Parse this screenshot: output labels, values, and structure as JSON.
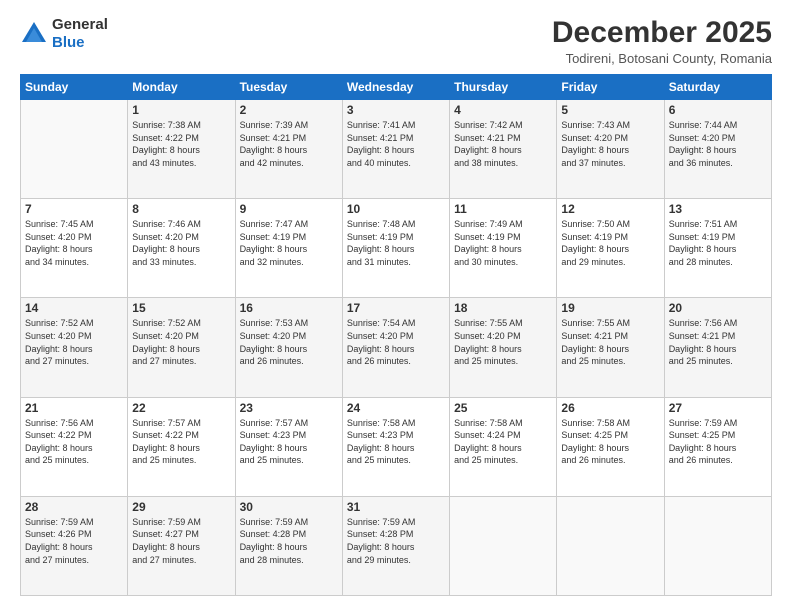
{
  "logo": {
    "general": "General",
    "blue": "Blue"
  },
  "header": {
    "month": "December 2025",
    "location": "Todireni, Botosani County, Romania"
  },
  "days_of_week": [
    "Sunday",
    "Monday",
    "Tuesday",
    "Wednesday",
    "Thursday",
    "Friday",
    "Saturday"
  ],
  "weeks": [
    [
      {
        "day": "",
        "info": ""
      },
      {
        "day": "1",
        "info": "Sunrise: 7:38 AM\nSunset: 4:22 PM\nDaylight: 8 hours\nand 43 minutes."
      },
      {
        "day": "2",
        "info": "Sunrise: 7:39 AM\nSunset: 4:21 PM\nDaylight: 8 hours\nand 42 minutes."
      },
      {
        "day": "3",
        "info": "Sunrise: 7:41 AM\nSunset: 4:21 PM\nDaylight: 8 hours\nand 40 minutes."
      },
      {
        "day": "4",
        "info": "Sunrise: 7:42 AM\nSunset: 4:21 PM\nDaylight: 8 hours\nand 38 minutes."
      },
      {
        "day": "5",
        "info": "Sunrise: 7:43 AM\nSunset: 4:20 PM\nDaylight: 8 hours\nand 37 minutes."
      },
      {
        "day": "6",
        "info": "Sunrise: 7:44 AM\nSunset: 4:20 PM\nDaylight: 8 hours\nand 36 minutes."
      }
    ],
    [
      {
        "day": "7",
        "info": "Sunrise: 7:45 AM\nSunset: 4:20 PM\nDaylight: 8 hours\nand 34 minutes."
      },
      {
        "day": "8",
        "info": "Sunrise: 7:46 AM\nSunset: 4:20 PM\nDaylight: 8 hours\nand 33 minutes."
      },
      {
        "day": "9",
        "info": "Sunrise: 7:47 AM\nSunset: 4:19 PM\nDaylight: 8 hours\nand 32 minutes."
      },
      {
        "day": "10",
        "info": "Sunrise: 7:48 AM\nSunset: 4:19 PM\nDaylight: 8 hours\nand 31 minutes."
      },
      {
        "day": "11",
        "info": "Sunrise: 7:49 AM\nSunset: 4:19 PM\nDaylight: 8 hours\nand 30 minutes."
      },
      {
        "day": "12",
        "info": "Sunrise: 7:50 AM\nSunset: 4:19 PM\nDaylight: 8 hours\nand 29 minutes."
      },
      {
        "day": "13",
        "info": "Sunrise: 7:51 AM\nSunset: 4:19 PM\nDaylight: 8 hours\nand 28 minutes."
      }
    ],
    [
      {
        "day": "14",
        "info": "Sunrise: 7:52 AM\nSunset: 4:20 PM\nDaylight: 8 hours\nand 27 minutes."
      },
      {
        "day": "15",
        "info": "Sunrise: 7:52 AM\nSunset: 4:20 PM\nDaylight: 8 hours\nand 27 minutes."
      },
      {
        "day": "16",
        "info": "Sunrise: 7:53 AM\nSunset: 4:20 PM\nDaylight: 8 hours\nand 26 minutes."
      },
      {
        "day": "17",
        "info": "Sunrise: 7:54 AM\nSunset: 4:20 PM\nDaylight: 8 hours\nand 26 minutes."
      },
      {
        "day": "18",
        "info": "Sunrise: 7:55 AM\nSunset: 4:20 PM\nDaylight: 8 hours\nand 25 minutes."
      },
      {
        "day": "19",
        "info": "Sunrise: 7:55 AM\nSunset: 4:21 PM\nDaylight: 8 hours\nand 25 minutes."
      },
      {
        "day": "20",
        "info": "Sunrise: 7:56 AM\nSunset: 4:21 PM\nDaylight: 8 hours\nand 25 minutes."
      }
    ],
    [
      {
        "day": "21",
        "info": "Sunrise: 7:56 AM\nSunset: 4:22 PM\nDaylight: 8 hours\nand 25 minutes."
      },
      {
        "day": "22",
        "info": "Sunrise: 7:57 AM\nSunset: 4:22 PM\nDaylight: 8 hours\nand 25 minutes."
      },
      {
        "day": "23",
        "info": "Sunrise: 7:57 AM\nSunset: 4:23 PM\nDaylight: 8 hours\nand 25 minutes."
      },
      {
        "day": "24",
        "info": "Sunrise: 7:58 AM\nSunset: 4:23 PM\nDaylight: 8 hours\nand 25 minutes."
      },
      {
        "day": "25",
        "info": "Sunrise: 7:58 AM\nSunset: 4:24 PM\nDaylight: 8 hours\nand 25 minutes."
      },
      {
        "day": "26",
        "info": "Sunrise: 7:58 AM\nSunset: 4:25 PM\nDaylight: 8 hours\nand 26 minutes."
      },
      {
        "day": "27",
        "info": "Sunrise: 7:59 AM\nSunset: 4:25 PM\nDaylight: 8 hours\nand 26 minutes."
      }
    ],
    [
      {
        "day": "28",
        "info": "Sunrise: 7:59 AM\nSunset: 4:26 PM\nDaylight: 8 hours\nand 27 minutes."
      },
      {
        "day": "29",
        "info": "Sunrise: 7:59 AM\nSunset: 4:27 PM\nDaylight: 8 hours\nand 27 minutes."
      },
      {
        "day": "30",
        "info": "Sunrise: 7:59 AM\nSunset: 4:28 PM\nDaylight: 8 hours\nand 28 minutes."
      },
      {
        "day": "31",
        "info": "Sunrise: 7:59 AM\nSunset: 4:28 PM\nDaylight: 8 hours\nand 29 minutes."
      },
      {
        "day": "",
        "info": ""
      },
      {
        "day": "",
        "info": ""
      },
      {
        "day": "",
        "info": ""
      }
    ]
  ]
}
